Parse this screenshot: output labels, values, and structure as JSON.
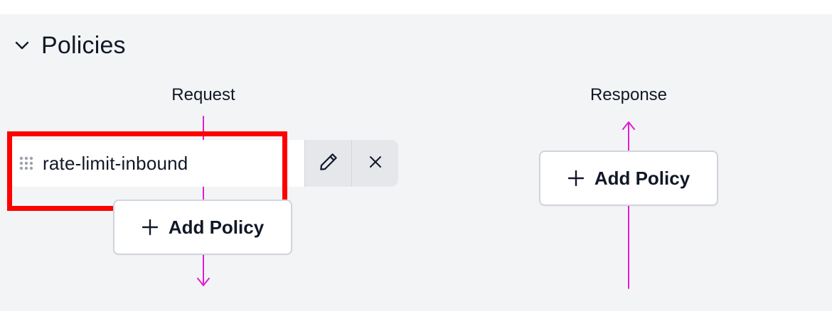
{
  "section": {
    "title": "Policies",
    "expanded": true,
    "chevron_icon": "chevron-down-icon"
  },
  "request": {
    "label": "Request",
    "policies": [
      {
        "name": "rate-limit-inbound",
        "edit_icon": "pencil-icon",
        "remove_icon": "close-icon"
      }
    ],
    "add_button_label": "Add Policy"
  },
  "response": {
    "label": "Response",
    "add_button_label": "Add Policy"
  },
  "colors": {
    "background": "#f3f4f6",
    "flow_arrow": "#e01ed0",
    "highlight": "#ff0000",
    "text": "#111827"
  }
}
